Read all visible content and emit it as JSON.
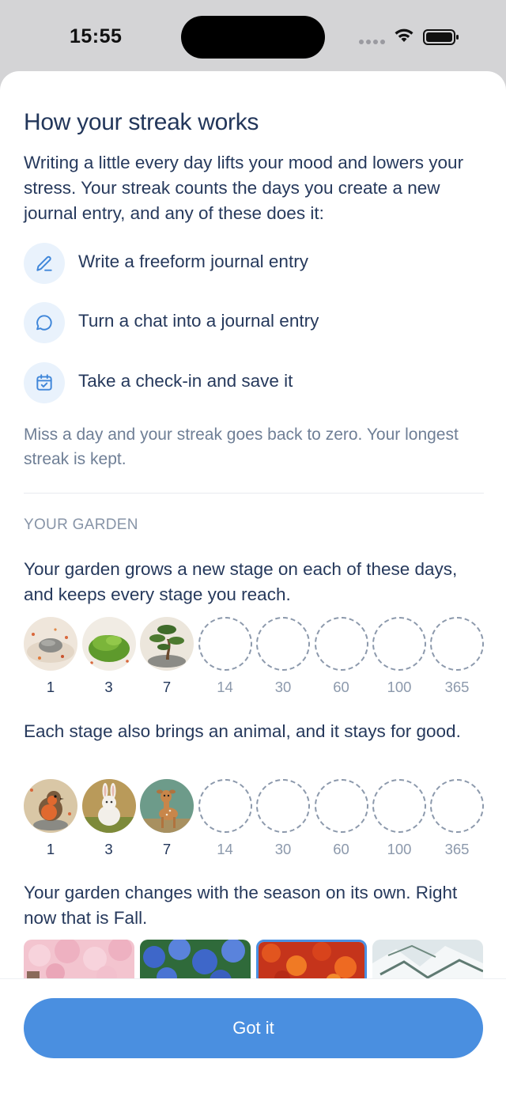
{
  "status_bar": {
    "time": "15:55"
  },
  "title": "How your streak works",
  "intro": "Writing a little every day lifts your mood and lowers your stress. Your streak counts the days you create a new journal entry, and any of these does it:",
  "methods": [
    {
      "icon": "pencil-icon",
      "label": "Write a freeform journal entry"
    },
    {
      "icon": "chat-bubble-icon",
      "label": "Turn a chat into a journal entry"
    },
    {
      "icon": "calendar-check-icon",
      "label": "Take a check-in and save it"
    }
  ],
  "note": "Miss a day and your streak goes back to zero. Your longest streak is kept.",
  "garden": {
    "section_label": "YOUR GARDEN",
    "stages_text": "Your garden grows a new stage on each of these days, and keeps every stage you reach.",
    "stages": [
      {
        "day": "1",
        "reached": true,
        "image": "stone-garden"
      },
      {
        "day": "3",
        "reached": true,
        "image": "moss-garden"
      },
      {
        "day": "7",
        "reached": true,
        "image": "bonsai-garden"
      },
      {
        "day": "14",
        "reached": false
      },
      {
        "day": "30",
        "reached": false
      },
      {
        "day": "60",
        "reached": false
      },
      {
        "day": "100",
        "reached": false
      },
      {
        "day": "365",
        "reached": false
      }
    ],
    "animals_text": "Each stage also brings an animal, and it stays for good.",
    "animals": [
      {
        "day": "1",
        "reached": true,
        "image": "robin"
      },
      {
        "day": "3",
        "reached": true,
        "image": "rabbit"
      },
      {
        "day": "7",
        "reached": true,
        "image": "deer"
      },
      {
        "day": "14",
        "reached": false
      },
      {
        "day": "30",
        "reached": false
      },
      {
        "day": "60",
        "reached": false
      },
      {
        "day": "100",
        "reached": false
      },
      {
        "day": "365",
        "reached": false
      }
    ],
    "season_text": "Your garden changes with the season on its own. Right now that is Fall.",
    "seasons": [
      {
        "name": "spring",
        "current": false
      },
      {
        "name": "summer",
        "current": false
      },
      {
        "name": "fall",
        "current": true
      },
      {
        "name": "winter",
        "current": false
      }
    ]
  },
  "button": {
    "label": "Got it"
  },
  "colors": {
    "accent": "#4a8fe0",
    "text": "#26395c",
    "muted": "#6f7f96"
  }
}
